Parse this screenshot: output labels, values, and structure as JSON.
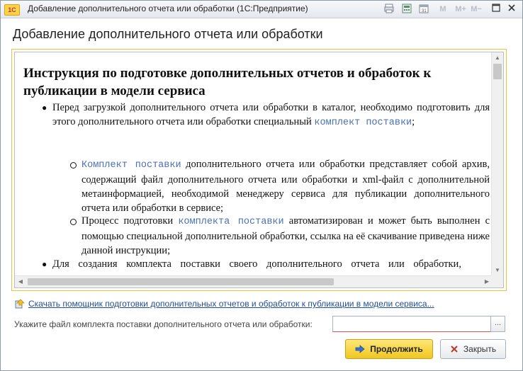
{
  "window": {
    "app_logo": "1С",
    "title": "Добавление дополнительного отчета или обработки (1С:Предприятие)",
    "toolbar": {
      "memory_m": "M",
      "memory_m_plus": "M+",
      "memory_m_minus": "M−"
    }
  },
  "form": {
    "title": "Добавление  дополнительного отчета или обработки"
  },
  "document": {
    "heading": "Инструкция по подготовке дополнительных отчетов и обработок к публикации в модели сервиса",
    "bullet1_text": "Перед загрузкой дополнительного отчета или обработки в каталог, необходимо подготовить для этого дополнительного отчета или обработки специальный ",
    "bullet1_link": "комплект поставки",
    "bullet1_tail": ";",
    "sub1_link": "Комплект поставки",
    "sub1_text": " дополнительного отчета или обработки представляет собой архив, содержащий файл дополнительного отчета или обработки и xml-файл с дополнительной метаинформацией, необходимой менеджеру сервиса для публикации дополнительного отчета или обработки в сервисе;",
    "sub2_text_a": "Процесс подготовки ",
    "sub2_link": "комплекта поставки",
    "sub2_text_b": " автоматизирован и может быть выполнен с помощью специальной дополнительной обработки, ссылка на её скачивание приведена ниже данной инструкции;",
    "bullet2_text": "Для создания комплекта поставки своего дополнительного отчета или обработки,"
  },
  "download_link": "Скачать помощник подготовки дополнительных отчетов и обработок к публикации в модели сервиса...",
  "file_field": {
    "label": "Укажите файл комплекта поставки дополнительного отчета или обработки:",
    "value": "",
    "select_button": "..."
  },
  "buttons": {
    "continue": "Продолжить",
    "close": "Закрыть"
  }
}
